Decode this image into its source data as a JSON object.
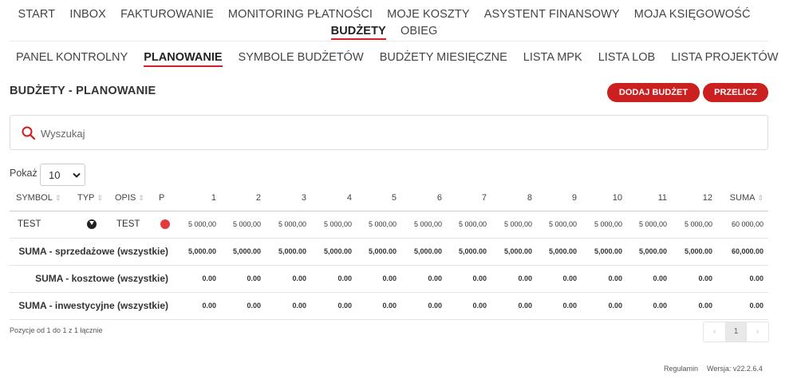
{
  "top_nav": {
    "row1": [
      "START",
      "INBOX",
      "FAKTUROWANIE",
      "MONITORING PŁATNOŚCI",
      "MOJE KOSZTY",
      "ASYSTENT FINANSOWY",
      "MOJA KSIĘGOWOŚĆ"
    ],
    "row2": [
      "BUDŻETY",
      "OBIEG"
    ],
    "active": "BUDŻETY"
  },
  "sub_nav": {
    "items": [
      "PANEL KONTROLNY",
      "PLANOWANIE",
      "SYMBOLE BUDŻETÓW",
      "BUDŻETY MIESIĘCZNE",
      "LISTA MPK",
      "LISTA LOB",
      "LISTA PROJEKTÓW"
    ],
    "active": "PLANOWANIE"
  },
  "page": {
    "title": "BUDŻETY - PLANOWANIE",
    "add_button": "DODAJ BUDŻET",
    "recalc_button": "PRZELICZ"
  },
  "search": {
    "placeholder": "Wyszukaj",
    "value": "",
    "icon": "search-icon"
  },
  "page_size": {
    "label": "Pokaż",
    "value": "10"
  },
  "table": {
    "columns": [
      "SYMBOL",
      "TYP",
      "OPIS",
      "P",
      "1",
      "2",
      "3",
      "4",
      "5",
      "6",
      "7",
      "8",
      "9",
      "10",
      "11",
      "12",
      "SUMA"
    ],
    "rows": [
      {
        "symbol": "TEST",
        "type_icon": "arrow-down-circle-icon",
        "description": "TEST",
        "priority_color": "#e23b3b",
        "months": [
          "5 000,00",
          "5 000,00",
          "5 000,00",
          "5 000,00",
          "5 000,00",
          "5 000,00",
          "5 000,00",
          "5 000,00",
          "5 000,00",
          "5 000,00",
          "5 000,00",
          "5 000,00"
        ],
        "sum": "60 000,00"
      }
    ],
    "totals": [
      {
        "label": "SUMA - sprzedażowe (wszystkie)",
        "months": [
          "5,000.00",
          "5,000.00",
          "5,000.00",
          "5,000.00",
          "5,000.00",
          "5,000.00",
          "5,000.00",
          "5,000.00",
          "5,000.00",
          "5,000.00",
          "5,000.00",
          "5,000.00"
        ],
        "sum": "60,000.00"
      },
      {
        "label": "SUMA - kosztowe (wszystkie)",
        "months": [
          "0.00",
          "0.00",
          "0.00",
          "0.00",
          "0.00",
          "0.00",
          "0.00",
          "0.00",
          "0.00",
          "0.00",
          "0.00",
          "0.00"
        ],
        "sum": "0.00"
      },
      {
        "label": "SUMA - inwestycyjne (wszystkie)",
        "months": [
          "0.00",
          "0.00",
          "0.00",
          "0.00",
          "0.00",
          "0.00",
          "0.00",
          "0.00",
          "0.00",
          "0.00",
          "0.00",
          "0.00"
        ],
        "sum": "0.00"
      }
    ]
  },
  "info": "Pozycje od 1 do 1 z 1 łącznie",
  "pagination": {
    "prev": "‹",
    "current": "1",
    "next": "›"
  },
  "footer": {
    "terms": "Regulamin",
    "version": "Wersja: v22.2.6.4"
  },
  "colors": {
    "accent": "#cc1f1f",
    "priority_red": "#e23b3b"
  }
}
